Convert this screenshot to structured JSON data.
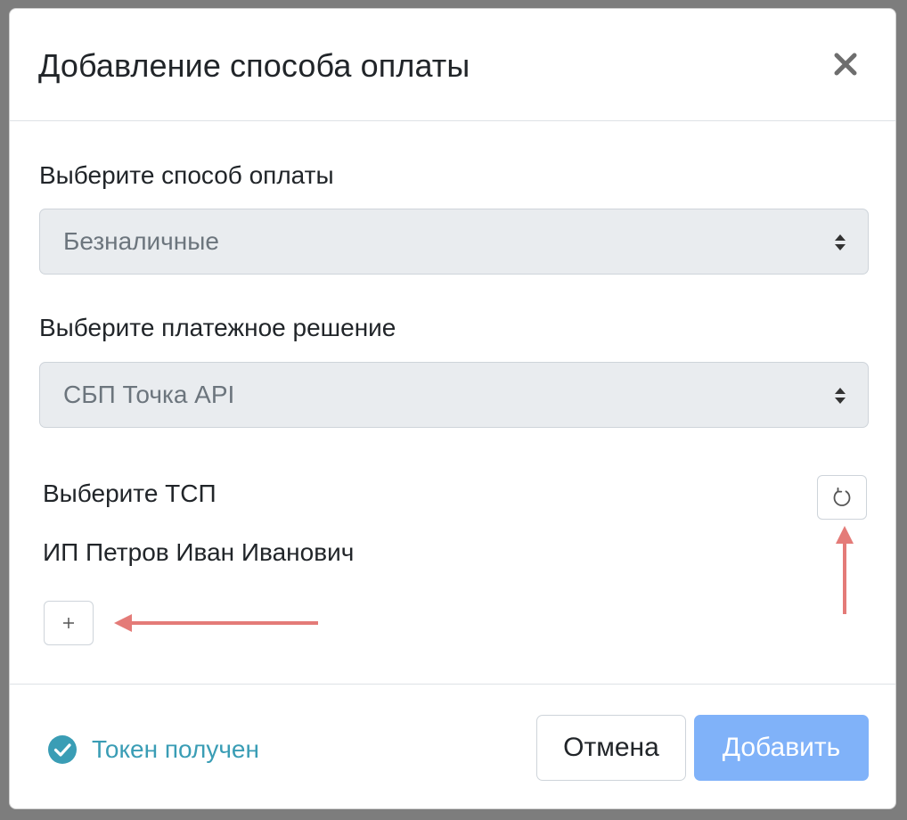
{
  "dialog": {
    "title": "Добавление способа оплаты"
  },
  "payment_method": {
    "label": "Выберите способ оплаты",
    "value": "Безналичные"
  },
  "payment_solution": {
    "label": "Выберите платежное решение",
    "value": "СБП Точка API"
  },
  "tsp": {
    "label": "Выберите ТСП",
    "value": "ИП Петров Иван Иванович",
    "add_symbol": "+"
  },
  "footer": {
    "token_status": "Токен получен",
    "cancel_label": "Отмена",
    "submit_label": "Добавить"
  },
  "icons": {
    "close": "close-icon",
    "select_arrows": "sort-arrows-icon",
    "refresh": "refresh-icon",
    "plus": "plus-icon",
    "check": "check-circle-icon"
  },
  "colors": {
    "token_status": "#3a9db5",
    "submit_button": "#80b2f9",
    "annotation_arrow": "#e47b78",
    "select_background": "#e9ecef"
  }
}
